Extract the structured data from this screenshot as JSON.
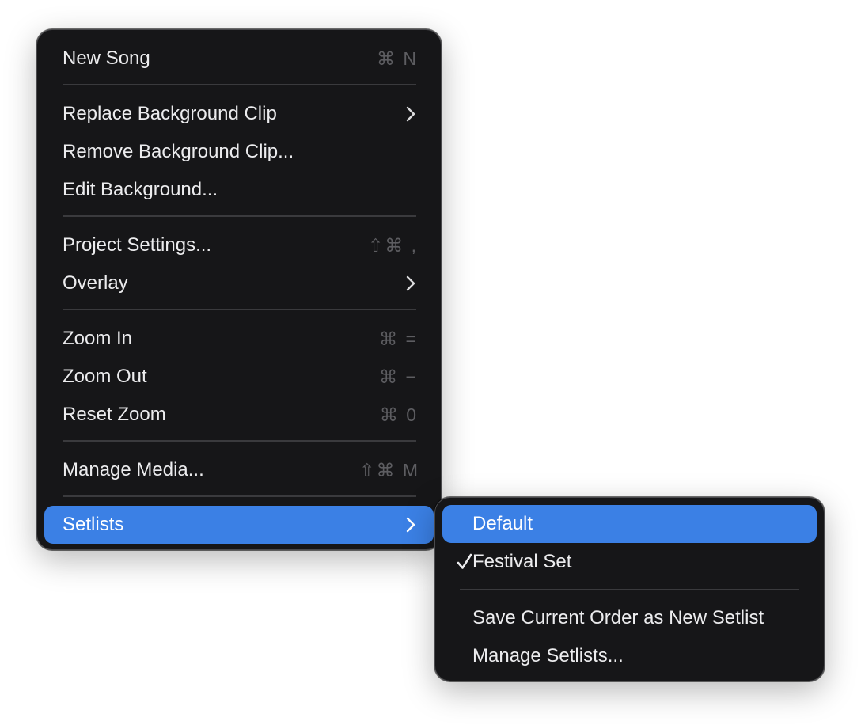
{
  "main_menu": {
    "new_song": {
      "label": "New Song",
      "shortcut": "⌘ N"
    },
    "replace_background_clip": {
      "label": "Replace Background Clip"
    },
    "remove_background_clip": {
      "label": "Remove Background Clip..."
    },
    "edit_background": {
      "label": "Edit Background..."
    },
    "project_settings": {
      "label": "Project Settings...",
      "shortcut": "⇧⌘ ,"
    },
    "overlay": {
      "label": "Overlay"
    },
    "zoom_in": {
      "label": "Zoom In",
      "shortcut": "⌘ ="
    },
    "zoom_out": {
      "label": "Zoom Out",
      "shortcut": "⌘ −"
    },
    "reset_zoom": {
      "label": "Reset Zoom",
      "shortcut": "⌘ 0"
    },
    "manage_media": {
      "label": "Manage Media...",
      "shortcut": "⇧⌘ M"
    },
    "setlists": {
      "label": "Setlists"
    }
  },
  "setlists_submenu": {
    "default": {
      "label": "Default"
    },
    "festival_set": {
      "label": "Festival Set",
      "checked": true
    },
    "save_current_order": {
      "label": "Save Current Order as New Setlist"
    },
    "manage_setlists": {
      "label": "Manage Setlists..."
    }
  },
  "colors": {
    "menu_background": "#161618",
    "highlight": "#3b80e5",
    "text": "#ececee",
    "shortcut_text": "#5d5d61"
  }
}
